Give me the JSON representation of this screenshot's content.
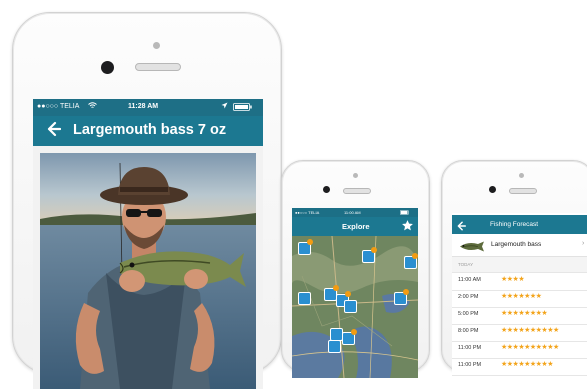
{
  "detail": {
    "status": {
      "carrier": "●●○○○ TELIA",
      "time": "11:28 AM"
    },
    "title": "Largemouth bass 7 oz"
  },
  "explore": {
    "status": {
      "carrier": "●●○○○ TELIA",
      "time": "11:00 AM"
    },
    "title": "Explore"
  },
  "forecast": {
    "title": "Fishing Forecast",
    "species": "Largemouth bass",
    "section": "TODAY",
    "rows": [
      {
        "time": "11:00 AM",
        "rating": 4
      },
      {
        "time": "2:00 PM",
        "rating": 7
      },
      {
        "time": "5:00 PM",
        "rating": 8
      },
      {
        "time": "8:00 PM",
        "rating": 10
      },
      {
        "time": "11:00 PM",
        "rating": 10
      },
      {
        "time": "11:00 PM",
        "rating": 9
      }
    ]
  },
  "icons": {
    "back": "back-arrow-icon",
    "star": "star-icon",
    "chevron": "chevron-right-icon",
    "wifi": "wifi-icon",
    "battery": "battery-icon",
    "location": "location-icon"
  },
  "colors": {
    "navbar": "#1c7891",
    "status": "#1e6f86",
    "star": "#f3a41b",
    "pin": "#2a8fd0"
  }
}
